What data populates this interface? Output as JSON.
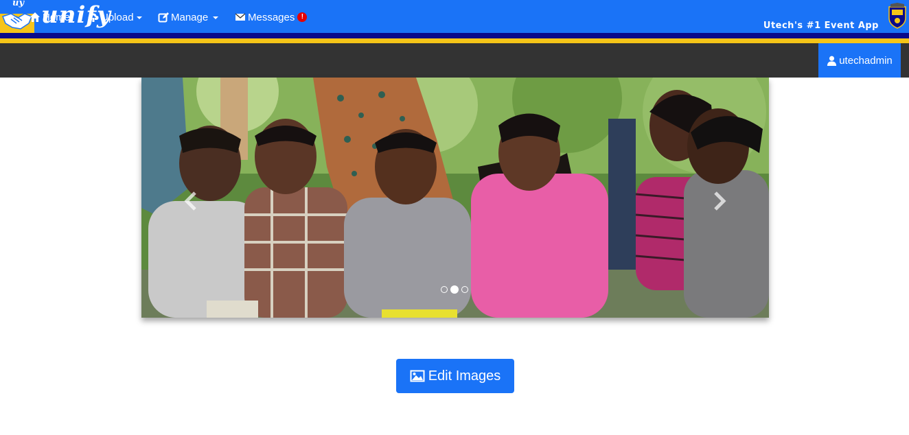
{
  "header": {
    "logo_mini": "uy",
    "brand_name": "unify",
    "tagline": "Utech's #1 Event App",
    "colors": {
      "banner": "#1a73f7",
      "dark_stripe": "#0a0a8a",
      "gold_stripe": "#f5c518"
    }
  },
  "navbar": {
    "items": [
      {
        "label": "Home",
        "icon": "home-icon"
      },
      {
        "label": "Upload",
        "icon": "cloud-upload-icon",
        "dropdown": true
      },
      {
        "label": "Manage",
        "icon": "edit-icon",
        "dropdown": true
      },
      {
        "label": "Messages",
        "icon": "envelope-icon",
        "badge": "!"
      }
    ],
    "user": {
      "label": "utechadmin",
      "icon": "user-icon"
    },
    "colors": {
      "background": "#333333",
      "active": "#1a73f7"
    }
  },
  "carousel": {
    "slide_count": 3,
    "active_index": 1,
    "controls": {
      "prev": "chevron-left-icon",
      "next": "chevron-right-icon"
    }
  },
  "actions": {
    "edit_images_label": "Edit Images",
    "edit_images_icon": "picture-icon"
  }
}
